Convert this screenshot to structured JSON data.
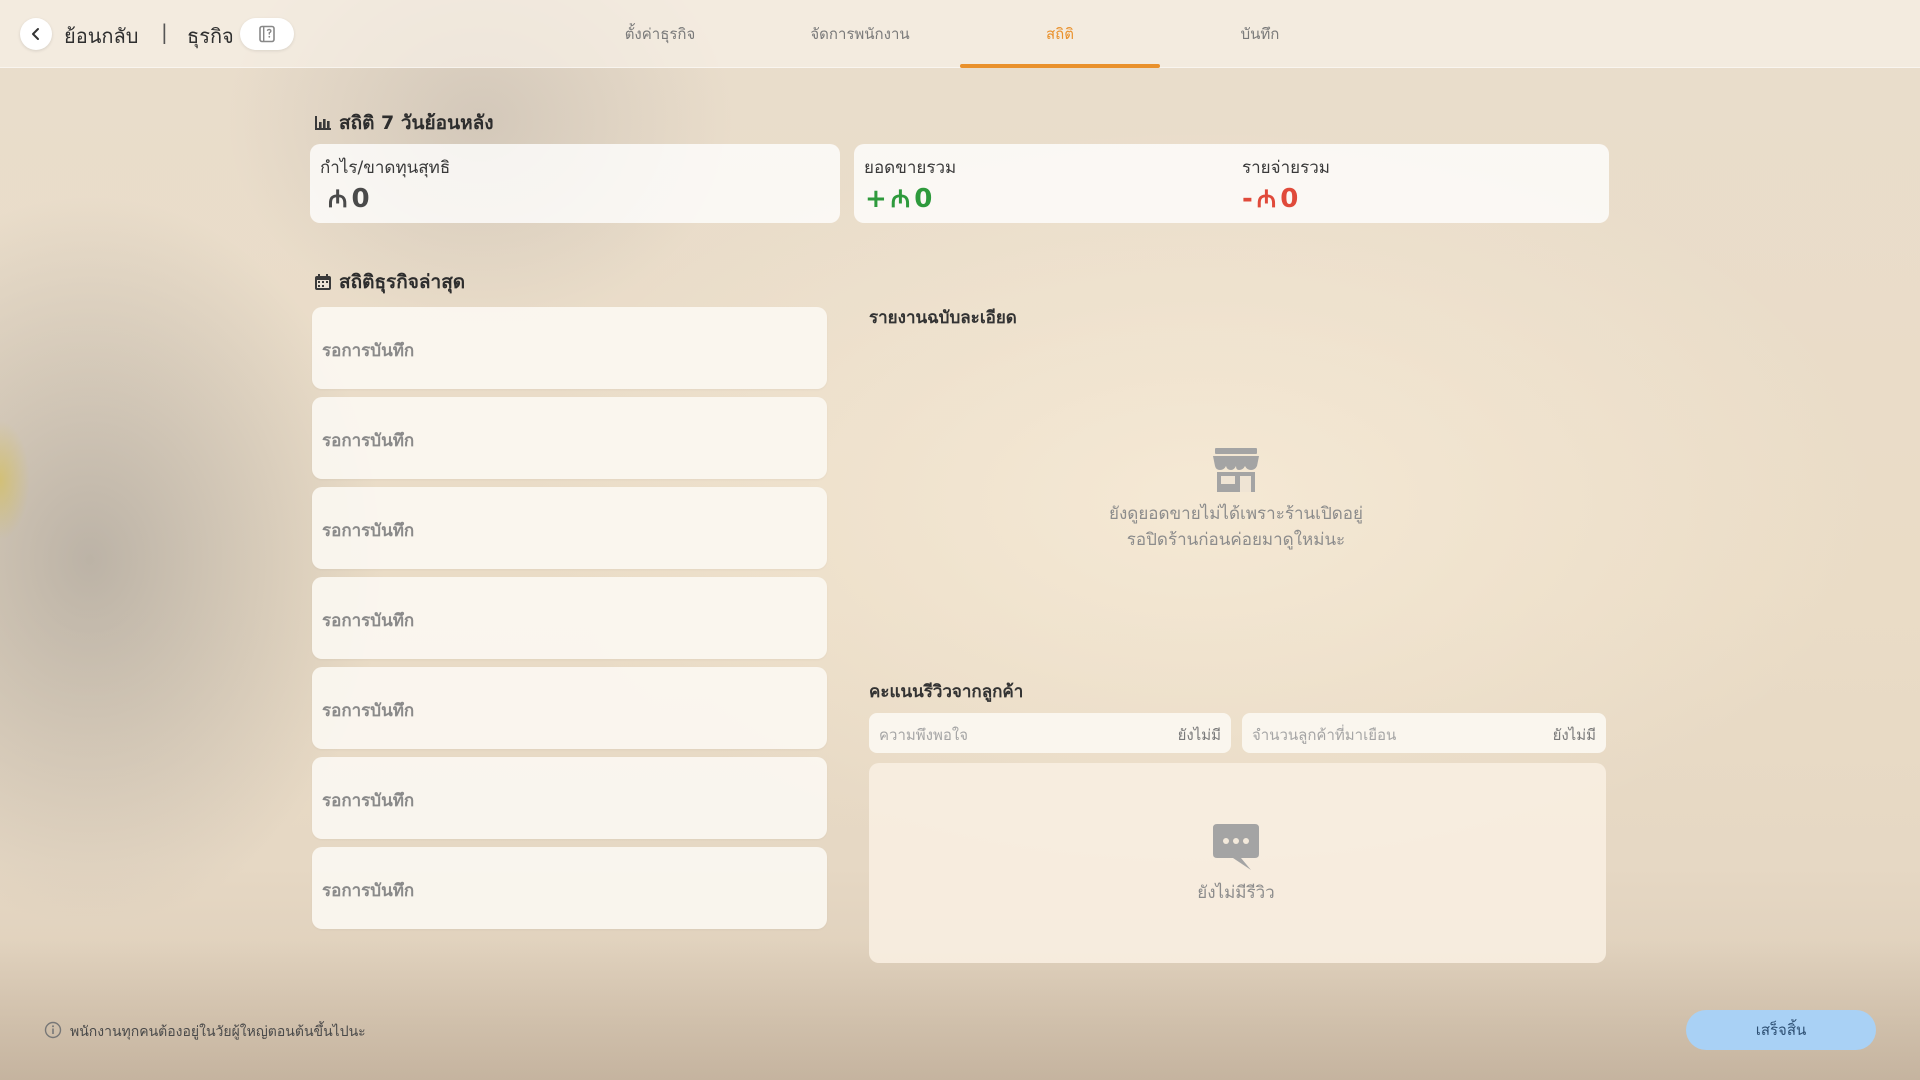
{
  "topbar": {
    "back_label": "ย้อนกลับ",
    "separator": "|",
    "business_label": "ธุรกิจ",
    "tabs": [
      {
        "label": "ตั้งค่าธุรกิจ",
        "active": false
      },
      {
        "label": "จัดการพนักงาน",
        "active": false
      },
      {
        "label": "สถิติ",
        "active": true
      },
      {
        "label": "บันทึก",
        "active": false
      }
    ]
  },
  "stats7": {
    "title": "สถิติ 7 วันย้อนหลัง",
    "net_profit": {
      "label": "กำไร/ขาดทุนสุทธิ",
      "sign": "",
      "currency": "₼",
      "value": "0"
    },
    "total_sales": {
      "label": "ยอดขายรวม",
      "sign": "+",
      "currency": "₼",
      "value": "0"
    },
    "total_expense": {
      "label": "รายจ่ายรวม",
      "sign": "-",
      "currency": "₼",
      "value": "0"
    }
  },
  "latest": {
    "title": "สถิติธุรกิจล่าสุด",
    "records": [
      {
        "label": "รอการบันทึก"
      },
      {
        "label": "รอการบันทึก"
      },
      {
        "label": "รอการบันทึก"
      },
      {
        "label": "รอการบันทึก"
      },
      {
        "label": "รอการบันทึก"
      },
      {
        "label": "รอการบันทึก"
      },
      {
        "label": "รอการบันทึก"
      }
    ]
  },
  "detail": {
    "title": "รายงานฉบับละเอียด",
    "empty_line1": "ยังดูยอดขายไม่ได้เพราะร้านเปิดอยู่",
    "empty_line2": "รอปิดร้านก่อนค่อยมาดูใหม่นะ"
  },
  "reviews": {
    "title": "คะแนนรีวิวจากลูกค้า",
    "satisfaction": {
      "label": "ความพึงพอใจ",
      "value": "ยังไม่มี"
    },
    "visitors": {
      "label": "จำนวนลูกค้าที่มาเยือน",
      "value": "ยังไม่มี"
    },
    "empty": "ยังไม่มีรีวิว"
  },
  "footer": {
    "note": "พนักงานทุกคนต้องอยู่ในวัยผู้ใหญ่ตอนต้นขึ้นไปนะ",
    "finish_label": "เสร็จสิ้น"
  },
  "colors": {
    "accent": "#e9912c",
    "positive": "#2e9a3c",
    "negative": "#e04a3a",
    "finish_button": "#a9d1f5"
  },
  "icons": [
    "back-arrow-icon",
    "book-icon",
    "bar-chart-icon",
    "calendar-icon",
    "shop-icon",
    "chat-bubble-icon",
    "info-icon"
  ]
}
